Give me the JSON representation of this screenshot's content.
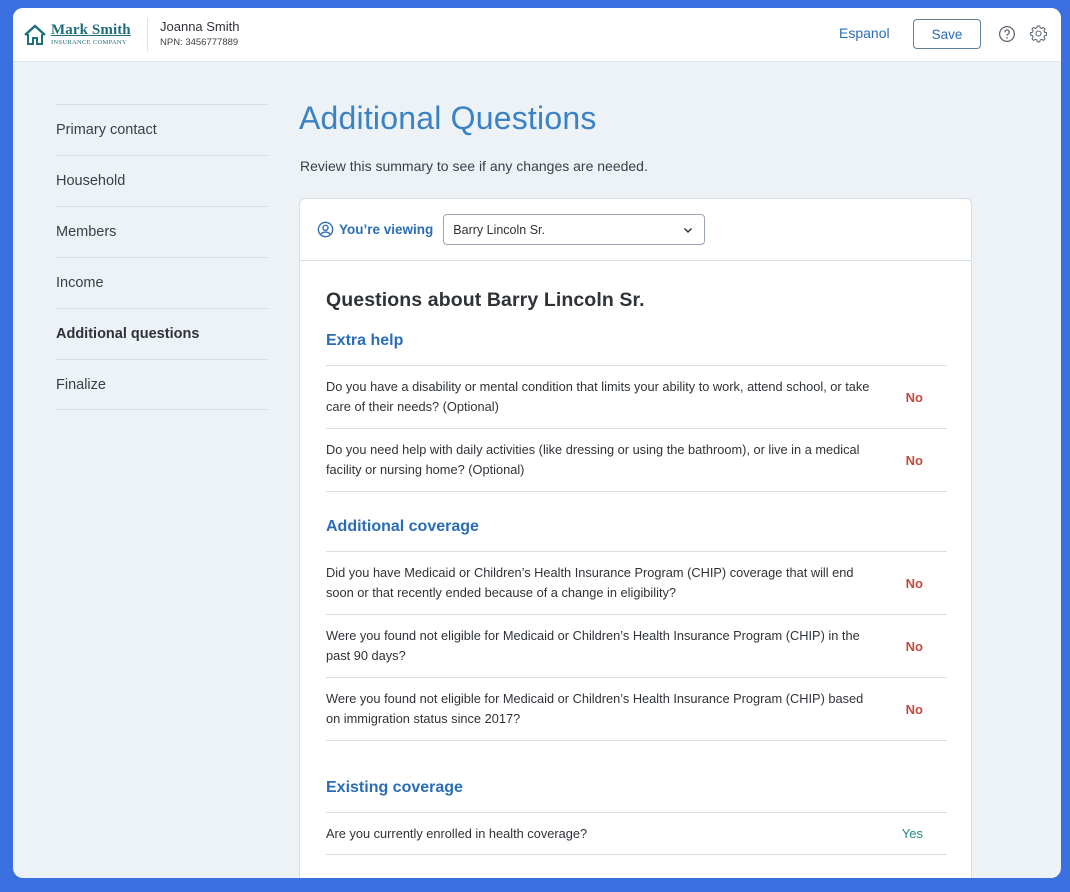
{
  "header": {
    "logo_name": "Mark Smith",
    "logo_sub": "INSURANCE COMPANY",
    "agent_name": "Joanna Smith",
    "agent_npn": "NPN: 3456777889",
    "lang_label": "Espanol",
    "save_label": "Save",
    "help_icon": "help-circle-icon",
    "settings_icon": "gear-icon"
  },
  "sidebar": {
    "items": [
      {
        "label": "Primary contact",
        "active": false
      },
      {
        "label": "Household",
        "active": false
      },
      {
        "label": "Members",
        "active": false
      },
      {
        "label": "Income",
        "active": false
      },
      {
        "label": "Additional questions",
        "active": true
      },
      {
        "label": "Finalize",
        "active": false
      }
    ]
  },
  "main": {
    "title": "Additional Questions",
    "subtitle": "Review this summary to see if any changes are needed.",
    "viewing_label": "You’re viewing",
    "viewing_selected": "Barry Lincoln Sr.",
    "section_heading": "Questions about Barry Lincoln Sr.",
    "groups": [
      {
        "title": "Extra help",
        "questions": [
          {
            "text": "Do you have a disability or mental condition that limits your ability to work, attend school, or take care of their needs? (Optional)",
            "answer": "No"
          },
          {
            "text": "Do you need help with daily activities (like dressing or using the bathroom), or live in a medical facility or nursing home? (Optional)",
            "answer": "No"
          }
        ]
      },
      {
        "title": "Additional coverage",
        "questions": [
          {
            "text": "Did you have Medicaid or Children’s Health Insurance Program (CHIP) coverage that will end soon or that recently ended because of a change in eligibility?",
            "answer": "No"
          },
          {
            "text": "Were you found not eligible for Medicaid or Children’s Health Insurance Program (CHIP) in the past 90 days?",
            "answer": "No"
          },
          {
            "text": "Were you found not eligible for Medicaid or Children’s Health Insurance Program (CHIP) based on immigration status since 2017?",
            "answer": "No"
          }
        ]
      },
      {
        "title": "Existing coverage",
        "questions": [
          {
            "text": "Are you currently enrolled in health coverage?",
            "answer": "Yes"
          }
        ]
      }
    ]
  },
  "colors": {
    "frame_blue": "#3a6fe0",
    "accent_blue": "#2a6db6",
    "answer_no": "#c44a3c",
    "answer_yes": "#1f8a7f"
  }
}
